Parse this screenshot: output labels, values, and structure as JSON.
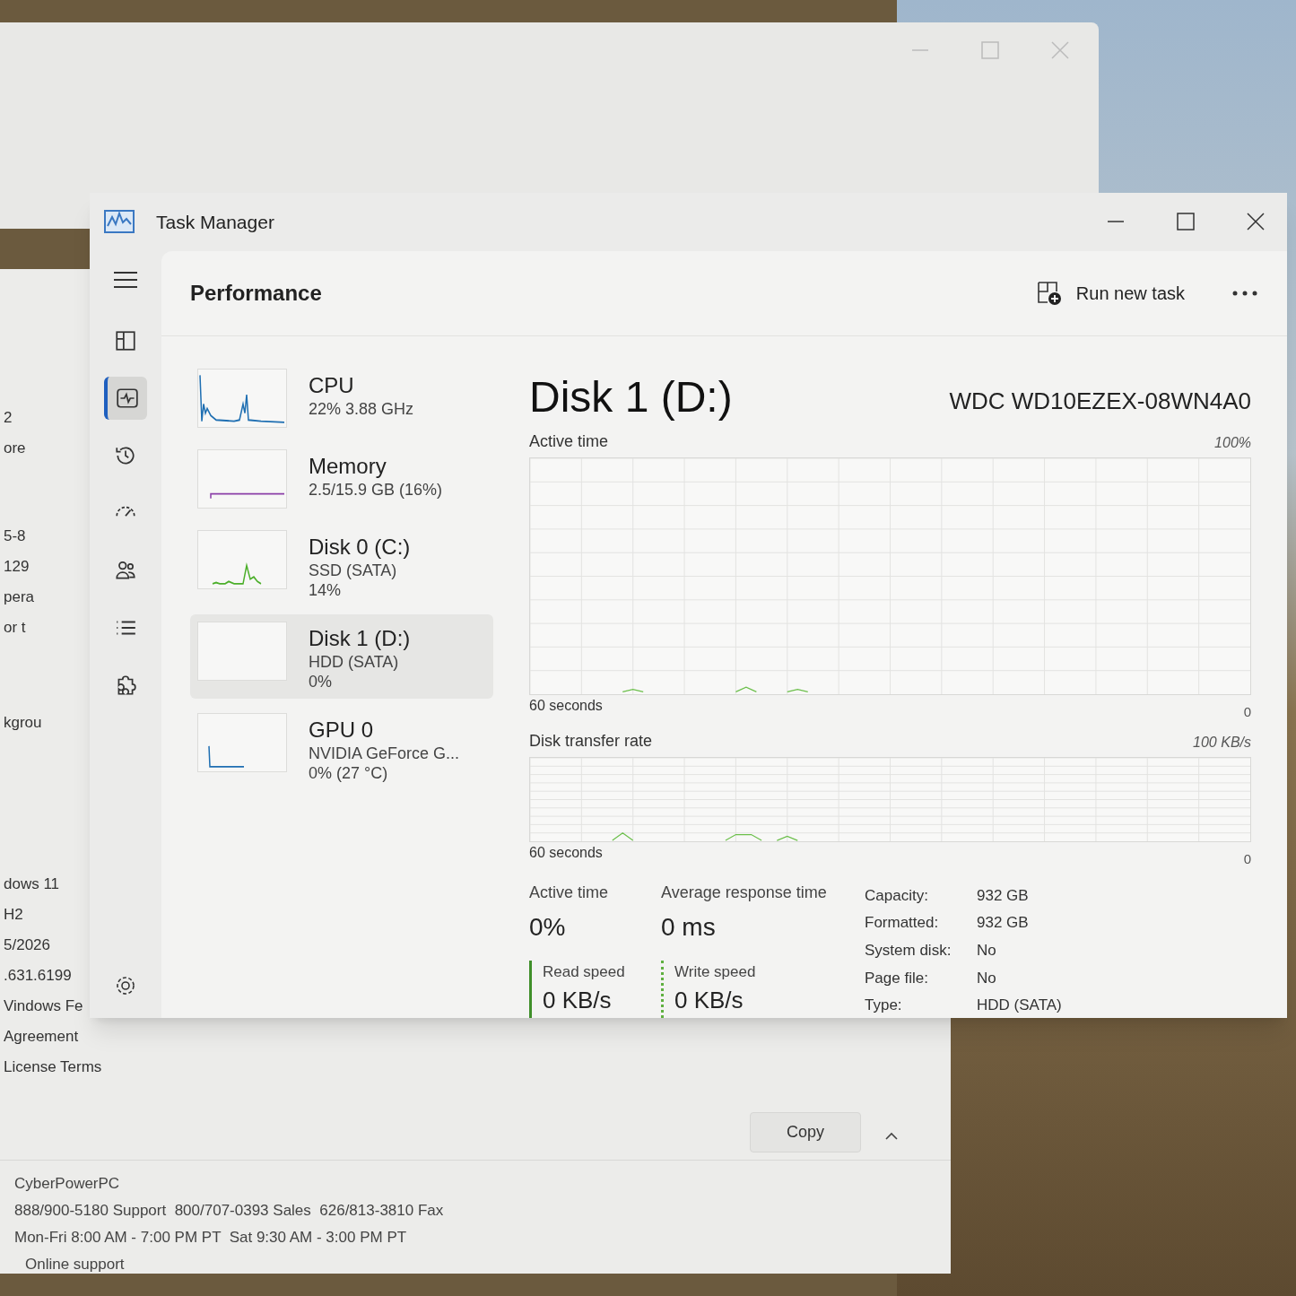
{
  "settings_window": {
    "fragment_groups": [
      [
        "2",
        "ore"
      ],
      [
        "5-8",
        "129",
        "pera",
        "or t"
      ],
      [
        "kgrou"
      ],
      [
        "dows 11",
        "H2",
        "5/2026",
        ".631.6199",
        "Vindows Fe"
      ],
      [
        "Agreement",
        "License Terms"
      ]
    ],
    "copy_button": "Copy",
    "support_lines": [
      "CyberPowerPC",
      "888/900-5180 Support  800/707-0393 Sales  626/813-3810 Fax",
      "Mon-Fri 8:00 AM - 7:00 PM PT  Sat 9:30 AM - 3:00 PM PT",
      "Online support"
    ]
  },
  "task_manager": {
    "title": "Task Manager",
    "nav": [
      {
        "kind": "processes",
        "selected": false
      },
      {
        "kind": "performance",
        "selected": true
      },
      {
        "kind": "app_history",
        "selected": false
      },
      {
        "kind": "startup",
        "selected": false
      },
      {
        "kind": "users",
        "selected": false
      },
      {
        "kind": "details",
        "selected": false
      },
      {
        "kind": "services",
        "selected": false
      }
    ],
    "page_title": "Performance",
    "run_new_task": "Run new task",
    "resources": [
      {
        "name": "CPU",
        "lines": [
          "22% 3.88 GHz"
        ],
        "color": "#1f6fb2",
        "selected": false
      },
      {
        "name": "Memory",
        "lines": [
          "2.5/15.9 GB (16%)"
        ],
        "color": "#8b3fa8",
        "selected": false
      },
      {
        "name": "Disk 0 (C:)",
        "lines": [
          "SSD (SATA)",
          "14%"
        ],
        "color": "#4caf2a",
        "selected": false
      },
      {
        "name": "Disk 1 (D:)",
        "lines": [
          "HDD (SATA)",
          "0%"
        ],
        "selected": true
      },
      {
        "name": "GPU 0",
        "lines": [
          "NVIDIA GeForce G...",
          "0% (27 °C)"
        ],
        "color": "#1f6fb2",
        "selected": false
      }
    ],
    "detail": {
      "title": "Disk 1 (D:)",
      "model": "WDC WD10EZEX-08WN4A0",
      "active_graph": {
        "label": "Active time",
        "max": "100%",
        "span": "60 seconds",
        "min": "0"
      },
      "transfer_graph": {
        "label": "Disk transfer rate",
        "max": "100 KB/s",
        "span": "60 seconds",
        "min": "0"
      },
      "stats": [
        {
          "label": "Active time",
          "value": "0%"
        },
        {
          "label": "Average response time",
          "value": "0 ms"
        }
      ],
      "speeds": [
        {
          "label": "Read speed",
          "value": "0 KB/s",
          "kind": "read"
        },
        {
          "label": "Write speed",
          "value": "0 KB/s",
          "kind": "write"
        }
      ],
      "properties": [
        {
          "key": "Capacity:",
          "value": "932 GB"
        },
        {
          "key": "Formatted:",
          "value": "932 GB"
        },
        {
          "key": "System disk:",
          "value": "No"
        },
        {
          "key": "Page file:",
          "value": "No"
        },
        {
          "key": "Type:",
          "value": "HDD (SATA)"
        }
      ]
    }
  }
}
